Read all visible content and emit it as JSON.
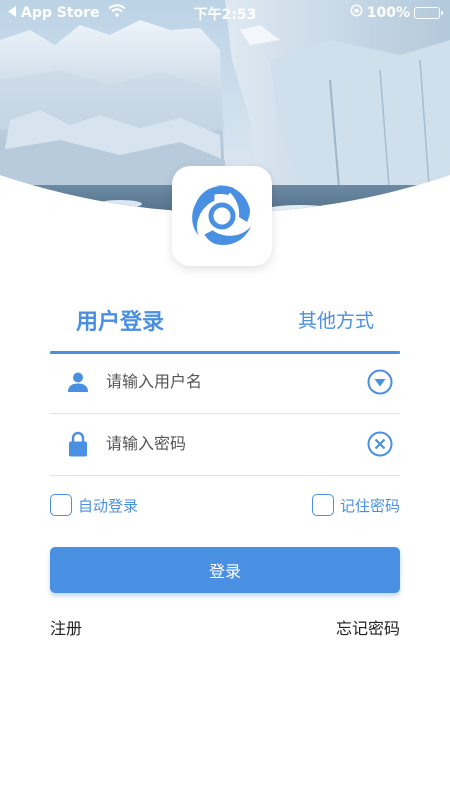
{
  "status_bar": {
    "back_label": "App Store",
    "time": "下午2:53",
    "battery": "100%"
  },
  "tabs": {
    "login": "用户登录",
    "other": "其他方式"
  },
  "username": {
    "placeholder": "请输入用户名",
    "value": ""
  },
  "password": {
    "placeholder": "请输入密码",
    "value": ""
  },
  "options": {
    "auto_login": "自动登录",
    "remember_password": "记住密码"
  },
  "login_button": "登录",
  "links": {
    "register": "注册",
    "forgot": "忘记密码"
  },
  "colors": {
    "accent": "#4a90e2",
    "battery": "#4cd964"
  },
  "icons": {
    "user": "user-icon",
    "lock": "lock-icon",
    "dropdown": "dropdown-circle-icon",
    "clear": "clear-circle-icon",
    "wifi": "wifi-icon",
    "back": "back-triangle-icon",
    "orientation": "orientation-lock-icon",
    "battery": "battery-icon",
    "logo": "app-logo"
  }
}
